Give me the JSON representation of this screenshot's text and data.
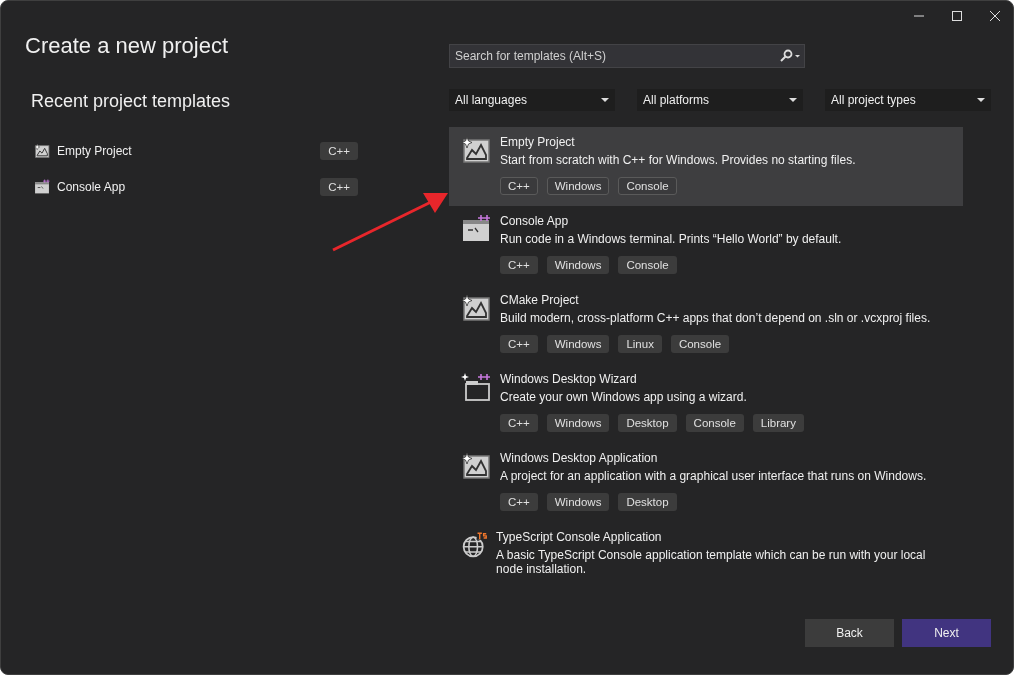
{
  "window": {
    "title": "Create a new project"
  },
  "recent": {
    "heading": "Recent project templates",
    "items": [
      {
        "name": "Empty Project",
        "kind": "image",
        "badge": "C++"
      },
      {
        "name": "Console App",
        "kind": "console",
        "badge": "C++"
      }
    ]
  },
  "search": {
    "placeholder": "Search for templates (Alt+S)"
  },
  "filters": [
    "All languages",
    "All platforms",
    "All project types"
  ],
  "templates": [
    {
      "name": "Empty Project",
      "description": "Start from scratch with C++ for Windows. Provides no starting files.",
      "kind": "image",
      "selected": true,
      "tags": [
        "C++",
        "Windows",
        "Console"
      ]
    },
    {
      "name": "Console App",
      "description": "Run code in a Windows terminal. Prints “Hello World” by default.",
      "kind": "console",
      "selected": false,
      "tags": [
        "C++",
        "Windows",
        "Console"
      ]
    },
    {
      "name": "CMake Project",
      "description": "Build modern, cross-platform C++ apps that don’t depend on .sln or .vcxproj files.",
      "kind": "image",
      "selected": false,
      "tags": [
        "C++",
        "Windows",
        "Linux",
        "Console"
      ]
    },
    {
      "name": "Windows Desktop Wizard",
      "description": "Create your own Windows app using a wizard.",
      "kind": "wizard",
      "selected": false,
      "tags": [
        "C++",
        "Windows",
        "Desktop",
        "Console",
        "Library"
      ]
    },
    {
      "name": "Windows Desktop Application",
      "description": "A project for an application with a graphical user interface that runs on Windows.",
      "kind": "image",
      "selected": false,
      "tags": [
        "C++",
        "Windows",
        "Desktop"
      ]
    },
    {
      "name": "TypeScript Console Application",
      "description": "A basic TypeScript Console application template which can be run with your local node installation.",
      "kind": "typescript",
      "selected": false
    }
  ],
  "buttons": {
    "back": "Back",
    "next": "Next"
  }
}
